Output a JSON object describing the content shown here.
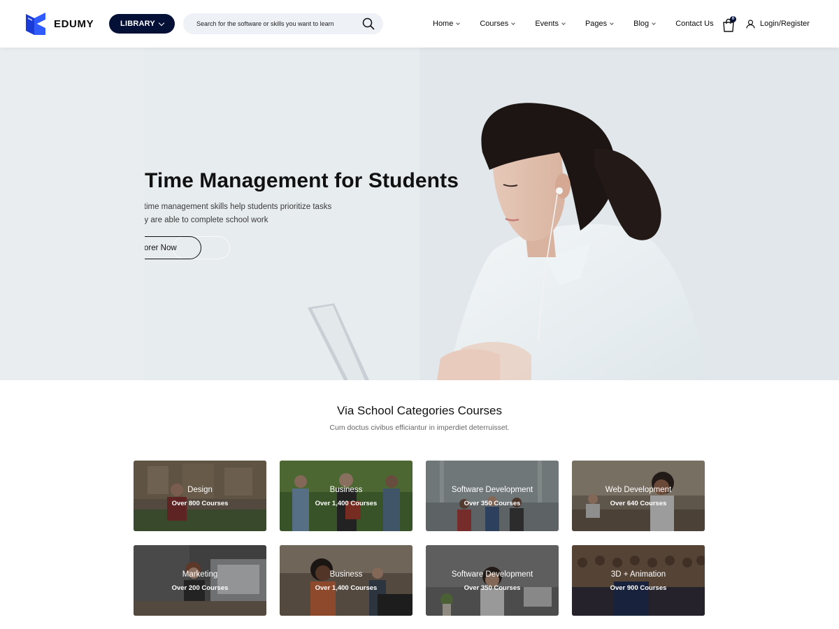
{
  "brand": {
    "name": "EDUMY",
    "accent": "#051036",
    "logo_colors": [
      "#1a3bd6",
      "#2f5bff"
    ]
  },
  "header": {
    "library_label": "LIBRARY",
    "search": {
      "placeholder": "Search for the software or skills you want to learn",
      "icon": "search-icon"
    },
    "nav": [
      {
        "label": "Home",
        "has_dropdown": true
      },
      {
        "label": "Courses",
        "has_dropdown": true
      },
      {
        "label": "Events",
        "has_dropdown": true
      },
      {
        "label": "Pages",
        "has_dropdown": true
      },
      {
        "label": "Blog",
        "has_dropdown": true
      },
      {
        "label": "Contact Us",
        "has_dropdown": false
      }
    ],
    "cart": {
      "icon": "shopping-bag-icon",
      "count": "0"
    },
    "login": {
      "icon": "user-icon",
      "label": "Login/Register"
    }
  },
  "hero": {
    "title": "Time Management for Students",
    "line1": "l time management skills help students prioritize tasks",
    "line2": "ey are able to complete school work",
    "button_label": "orer Now"
  },
  "categories": {
    "title": "Via School Categories Courses",
    "subtitle": "Cum doctus civibus efficiantur in imperdiet deterruisset.",
    "items": [
      {
        "name": "Design",
        "count": "Over 800 Courses"
      },
      {
        "name": "Business",
        "count": "Over 1,400 Courses"
      },
      {
        "name": "Software Development",
        "count": "Over 350 Courses"
      },
      {
        "name": "Web Development",
        "count": "Over 640 Courses"
      },
      {
        "name": "Marketing",
        "count": "Over 200 Courses"
      },
      {
        "name": "Business",
        "count": "Over 1,400 Courses"
      },
      {
        "name": "Software Development",
        "count": "Over 350 Courses"
      },
      {
        "name": "3D + Animation",
        "count": "Over 900 Courses"
      }
    ]
  }
}
